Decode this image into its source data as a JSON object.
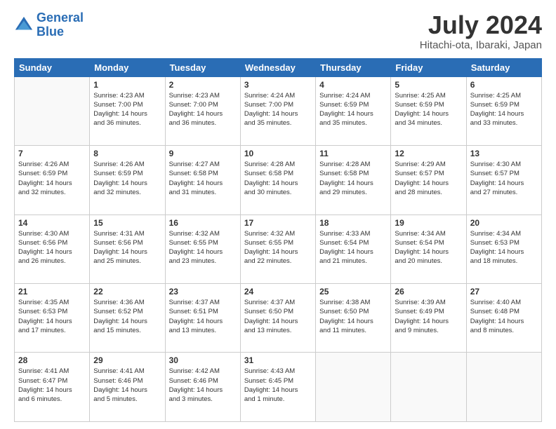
{
  "logo": {
    "line1": "General",
    "line2": "Blue"
  },
  "title": "July 2024",
  "location": "Hitachi-ota, Ibaraki, Japan",
  "headers": [
    "Sunday",
    "Monday",
    "Tuesday",
    "Wednesday",
    "Thursday",
    "Friday",
    "Saturday"
  ],
  "weeks": [
    [
      {
        "num": "",
        "info": ""
      },
      {
        "num": "1",
        "info": "Sunrise: 4:23 AM\nSunset: 7:00 PM\nDaylight: 14 hours\nand 36 minutes."
      },
      {
        "num": "2",
        "info": "Sunrise: 4:23 AM\nSunset: 7:00 PM\nDaylight: 14 hours\nand 36 minutes."
      },
      {
        "num": "3",
        "info": "Sunrise: 4:24 AM\nSunset: 7:00 PM\nDaylight: 14 hours\nand 35 minutes."
      },
      {
        "num": "4",
        "info": "Sunrise: 4:24 AM\nSunset: 6:59 PM\nDaylight: 14 hours\nand 35 minutes."
      },
      {
        "num": "5",
        "info": "Sunrise: 4:25 AM\nSunset: 6:59 PM\nDaylight: 14 hours\nand 34 minutes."
      },
      {
        "num": "6",
        "info": "Sunrise: 4:25 AM\nSunset: 6:59 PM\nDaylight: 14 hours\nand 33 minutes."
      }
    ],
    [
      {
        "num": "7",
        "info": "Sunrise: 4:26 AM\nSunset: 6:59 PM\nDaylight: 14 hours\nand 32 minutes."
      },
      {
        "num": "8",
        "info": "Sunrise: 4:26 AM\nSunset: 6:59 PM\nDaylight: 14 hours\nand 32 minutes."
      },
      {
        "num": "9",
        "info": "Sunrise: 4:27 AM\nSunset: 6:58 PM\nDaylight: 14 hours\nand 31 minutes."
      },
      {
        "num": "10",
        "info": "Sunrise: 4:28 AM\nSunset: 6:58 PM\nDaylight: 14 hours\nand 30 minutes."
      },
      {
        "num": "11",
        "info": "Sunrise: 4:28 AM\nSunset: 6:58 PM\nDaylight: 14 hours\nand 29 minutes."
      },
      {
        "num": "12",
        "info": "Sunrise: 4:29 AM\nSunset: 6:57 PM\nDaylight: 14 hours\nand 28 minutes."
      },
      {
        "num": "13",
        "info": "Sunrise: 4:30 AM\nSunset: 6:57 PM\nDaylight: 14 hours\nand 27 minutes."
      }
    ],
    [
      {
        "num": "14",
        "info": "Sunrise: 4:30 AM\nSunset: 6:56 PM\nDaylight: 14 hours\nand 26 minutes."
      },
      {
        "num": "15",
        "info": "Sunrise: 4:31 AM\nSunset: 6:56 PM\nDaylight: 14 hours\nand 25 minutes."
      },
      {
        "num": "16",
        "info": "Sunrise: 4:32 AM\nSunset: 6:55 PM\nDaylight: 14 hours\nand 23 minutes."
      },
      {
        "num": "17",
        "info": "Sunrise: 4:32 AM\nSunset: 6:55 PM\nDaylight: 14 hours\nand 22 minutes."
      },
      {
        "num": "18",
        "info": "Sunrise: 4:33 AM\nSunset: 6:54 PM\nDaylight: 14 hours\nand 21 minutes."
      },
      {
        "num": "19",
        "info": "Sunrise: 4:34 AM\nSunset: 6:54 PM\nDaylight: 14 hours\nand 20 minutes."
      },
      {
        "num": "20",
        "info": "Sunrise: 4:34 AM\nSunset: 6:53 PM\nDaylight: 14 hours\nand 18 minutes."
      }
    ],
    [
      {
        "num": "21",
        "info": "Sunrise: 4:35 AM\nSunset: 6:53 PM\nDaylight: 14 hours\nand 17 minutes."
      },
      {
        "num": "22",
        "info": "Sunrise: 4:36 AM\nSunset: 6:52 PM\nDaylight: 14 hours\nand 15 minutes."
      },
      {
        "num": "23",
        "info": "Sunrise: 4:37 AM\nSunset: 6:51 PM\nDaylight: 14 hours\nand 13 minutes."
      },
      {
        "num": "24",
        "info": "Sunrise: 4:37 AM\nSunset: 6:50 PM\nDaylight: 14 hours\nand 13 minutes."
      },
      {
        "num": "25",
        "info": "Sunrise: 4:38 AM\nSunset: 6:50 PM\nDaylight: 14 hours\nand 11 minutes."
      },
      {
        "num": "26",
        "info": "Sunrise: 4:39 AM\nSunset: 6:49 PM\nDaylight: 14 hours\nand 9 minutes."
      },
      {
        "num": "27",
        "info": "Sunrise: 4:40 AM\nSunset: 6:48 PM\nDaylight: 14 hours\nand 8 minutes."
      }
    ],
    [
      {
        "num": "28",
        "info": "Sunrise: 4:41 AM\nSunset: 6:47 PM\nDaylight: 14 hours\nand 6 minutes."
      },
      {
        "num": "29",
        "info": "Sunrise: 4:41 AM\nSunset: 6:46 PM\nDaylight: 14 hours\nand 5 minutes."
      },
      {
        "num": "30",
        "info": "Sunrise: 4:42 AM\nSunset: 6:46 PM\nDaylight: 14 hours\nand 3 minutes."
      },
      {
        "num": "31",
        "info": "Sunrise: 4:43 AM\nSunset: 6:45 PM\nDaylight: 14 hours\nand 1 minute."
      },
      {
        "num": "",
        "info": ""
      },
      {
        "num": "",
        "info": ""
      },
      {
        "num": "",
        "info": ""
      }
    ]
  ]
}
